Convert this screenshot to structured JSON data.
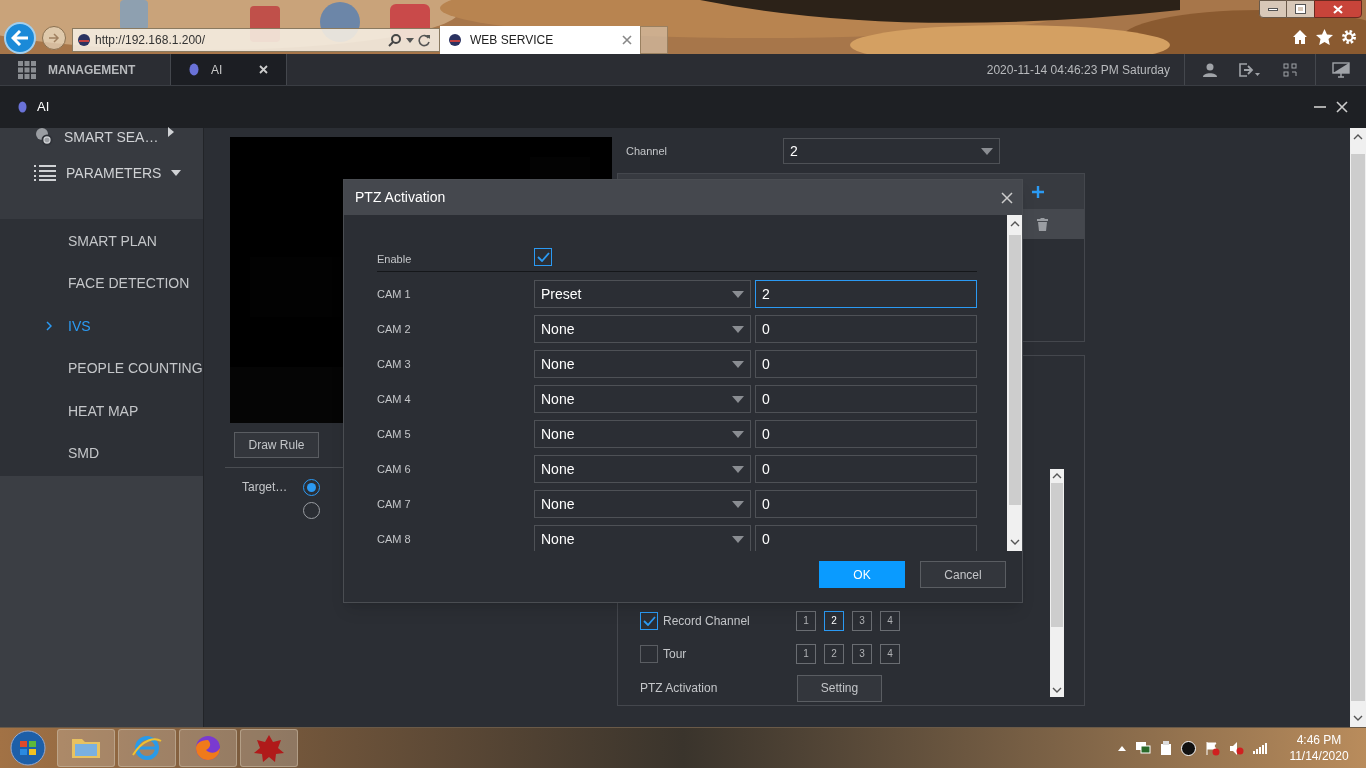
{
  "browser": {
    "address": "http://192.168.1.200/",
    "tab_title": "WEB SERVICE"
  },
  "app_bar": {
    "tabs": [
      {
        "label": "MANAGEMENT",
        "selected": false
      },
      {
        "label": "AI",
        "selected": true
      }
    ],
    "datetime": "2020-11-14 04:46:23 PM Saturday"
  },
  "page_title": "AI",
  "sidebar": {
    "items": [
      {
        "label": "SMART SEA…",
        "expanded": false
      },
      {
        "label": "PARAMETERS",
        "expanded": true,
        "children": [
          {
            "label": "SMART PLAN",
            "selected": false
          },
          {
            "label": "FACE DETECTION",
            "selected": false
          },
          {
            "label": "IVS",
            "selected": true
          },
          {
            "label": "PEOPLE COUNTING",
            "selected": false
          },
          {
            "label": "HEAT MAP",
            "selected": false
          },
          {
            "label": "SMD",
            "selected": false
          }
        ]
      }
    ]
  },
  "rule_editor": {
    "draw_rule_button": "Draw Rule",
    "target_label": "Target…",
    "target_options": [
      {
        "selected": true
      },
      {
        "selected": false
      }
    ]
  },
  "channel": {
    "label": "Channel",
    "value": "2"
  },
  "actions": {
    "record_channel": {
      "label": "Record Channel",
      "checked": true,
      "channels": [
        {
          "label": "1",
          "selected": false
        },
        {
          "label": "2",
          "selected": true
        },
        {
          "label": "3",
          "selected": false
        },
        {
          "label": "4",
          "selected": false
        }
      ]
    },
    "tour": {
      "label": "Tour",
      "checked": false,
      "channels": [
        {
          "label": "1",
          "selected": false
        },
        {
          "label": "2",
          "selected": false
        },
        {
          "label": "3",
          "selected": false
        },
        {
          "label": "4",
          "selected": false
        }
      ]
    },
    "ptz_activation": {
      "label": "PTZ Activation",
      "button": "Setting"
    }
  },
  "dialog": {
    "title": "PTZ Activation",
    "enable": {
      "label": "Enable",
      "checked": true
    },
    "cams": [
      {
        "label": "CAM 1",
        "type": "Preset",
        "value": "2",
        "focused": true
      },
      {
        "label": "CAM 2",
        "type": "None",
        "value": "0",
        "focused": false
      },
      {
        "label": "CAM 3",
        "type": "None",
        "value": "0",
        "focused": false
      },
      {
        "label": "CAM 4",
        "type": "None",
        "value": "0",
        "focused": false
      },
      {
        "label": "CAM 5",
        "type": "None",
        "value": "0",
        "focused": false
      },
      {
        "label": "CAM 6",
        "type": "None",
        "value": "0",
        "focused": false
      },
      {
        "label": "CAM 7",
        "type": "None",
        "value": "0",
        "focused": false
      },
      {
        "label": "CAM 8",
        "type": "None",
        "value": "0",
        "focused": false
      }
    ],
    "buttons": [
      {
        "label": "OK",
        "kind": "primary"
      },
      {
        "label": "Cancel",
        "kind": "secondary"
      }
    ]
  },
  "taskbar": {
    "time": "4:46 PM",
    "date": "11/14/2020"
  }
}
